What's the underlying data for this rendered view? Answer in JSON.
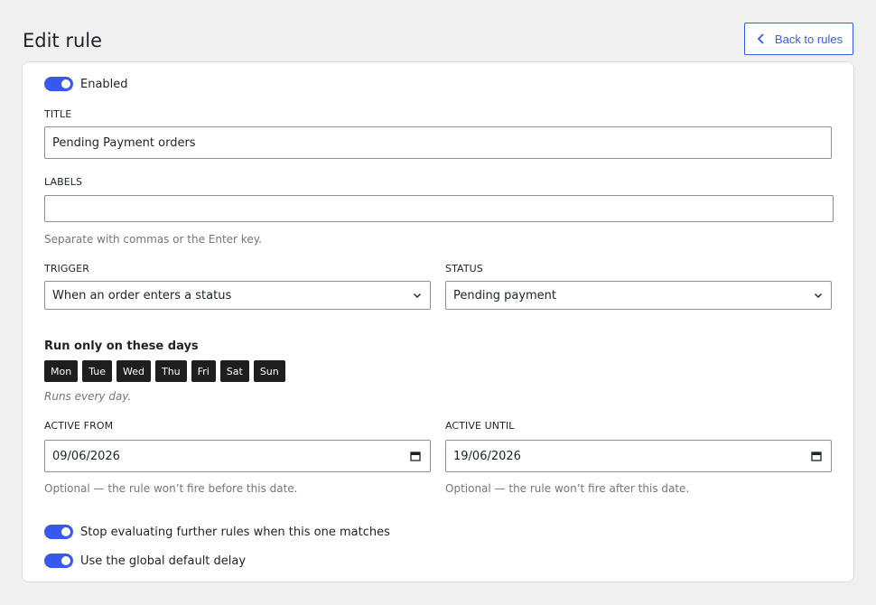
{
  "header": {
    "title": "Edit rule",
    "back_label": "Back to rules"
  },
  "form": {
    "enabled_label": "Enabled",
    "title_label": "TITLE",
    "title_value": "Pending Payment orders",
    "labels_label": "LABELS",
    "labels_value": "",
    "labels_help": "Separate with commas or the Enter key.",
    "trigger_label": "TRIGGER",
    "trigger_value": "When an order enters a status",
    "status_label": "STATUS",
    "status_value": "Pending payment",
    "days_title": "Run only on these days",
    "days": [
      "Mon",
      "Tue",
      "Wed",
      "Thu",
      "Fri",
      "Sat",
      "Sun"
    ],
    "days_help": "Runs every day.",
    "active_from_label": "ACTIVE FROM",
    "active_from_value": "09/06/2026",
    "active_from_help": "Optional — the rule won’t fire before this date.",
    "active_until_label": "ACTIVE UNTIL",
    "active_until_value": "19/06/2026",
    "active_until_help": "Optional — the rule won’t fire after this date.",
    "stop_label": "Stop evaluating further rules when this one matches",
    "global_delay_label": "Use the global default delay"
  },
  "colors": {
    "accent": "#3858e9",
    "day_chip": "#1e1e1e",
    "background": "#f0f0f1"
  }
}
